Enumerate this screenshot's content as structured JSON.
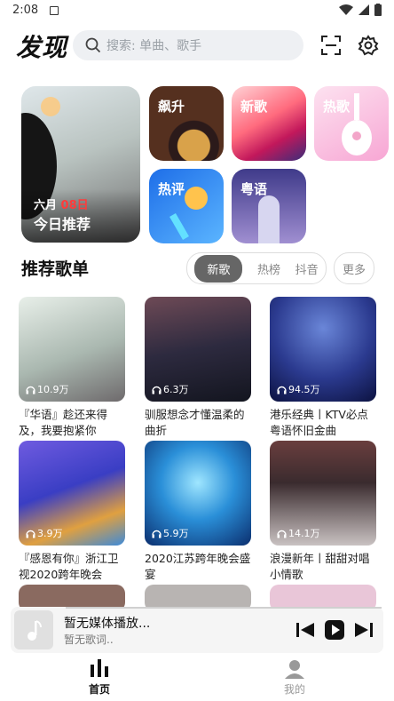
{
  "status": {
    "time": "2:08"
  },
  "header": {
    "logo": "发现",
    "search_placeholder": "搜索: 单曲、歌手"
  },
  "tiles": {
    "daily": {
      "month": "六月",
      "day": "08日",
      "title": "今日推荐"
    },
    "items": [
      {
        "label": "飙升"
      },
      {
        "label": "新歌"
      },
      {
        "label": "热歌"
      },
      {
        "label": "热评"
      },
      {
        "label": "粤语"
      }
    ]
  },
  "section": {
    "title": "推荐歌单",
    "tabs": [
      {
        "label": "新歌"
      },
      {
        "label": "热榜"
      },
      {
        "label": "抖音"
      }
    ],
    "more": "更多"
  },
  "playlists": [
    {
      "count": "10.9万",
      "title": "『华语』趁还来得及，我要抱紧你"
    },
    {
      "count": "6.3万",
      "title": "驯服想念才懂温柔的曲折"
    },
    {
      "count": "94.5万",
      "title": "港乐经典丨KTV必点粤语怀旧金曲"
    },
    {
      "count": "3.9万",
      "title": "『感恩有你』浙江卫视2020跨年晚会"
    },
    {
      "count": "5.9万",
      "title": "2020江苏跨年晚会盛宴"
    },
    {
      "count": "14.1万",
      "title": "浪漫新年丨甜甜对唱小情歌"
    }
  ],
  "player": {
    "title": "暂无媒体播放...",
    "lyric": "暂无歌词.."
  },
  "nav": {
    "home": "首页",
    "mine": "我的"
  },
  "colors": {
    "accent": "#111111",
    "search_bg": "#eef0f3"
  }
}
